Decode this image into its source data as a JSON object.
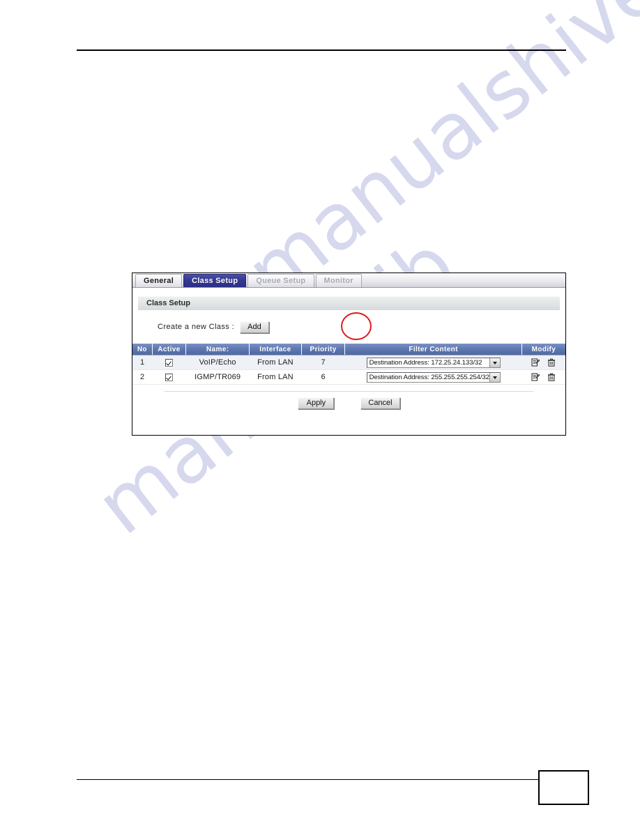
{
  "page": {
    "page_number": ""
  },
  "watermark": {
    "line1": "manualshive.com",
    "line2": "manualslib"
  },
  "panel": {
    "tabs": [
      {
        "label": "General",
        "state": "inactive"
      },
      {
        "label": "Class Setup",
        "state": "active"
      },
      {
        "label": "Queue Setup",
        "state": "disabled"
      },
      {
        "label": "Monitor",
        "state": "disabled"
      }
    ],
    "section_title": "Class Setup",
    "create": {
      "label": "Create a new Class :",
      "add_button": "Add"
    },
    "table": {
      "headers": [
        "No",
        "Active",
        "Name:",
        "Interface",
        "Priority",
        "Filter Content",
        "Modify"
      ],
      "rows": [
        {
          "no": "1",
          "active": true,
          "name": "VoIP/Echo",
          "interface": "From LAN",
          "priority": "7",
          "filter_content": "Destination Address: 172.25.24.133/32",
          "edit_icon": "edit-icon",
          "delete_icon": "trash-icon"
        },
        {
          "no": "2",
          "active": true,
          "name": "IGMP/TR069",
          "interface": "From LAN",
          "priority": "6",
          "filter_content": "Destination Address: 255.255.255.254/32",
          "edit_icon": "edit-icon",
          "delete_icon": "trash-icon"
        }
      ]
    },
    "footer": {
      "apply_label": "Apply",
      "cancel_label": "Cancel"
    }
  },
  "colors": {
    "active_tab": "#2f3390",
    "table_header": "#5f79b2",
    "annotation": "#dd1b1b",
    "row_alt": "#eef1f6"
  }
}
